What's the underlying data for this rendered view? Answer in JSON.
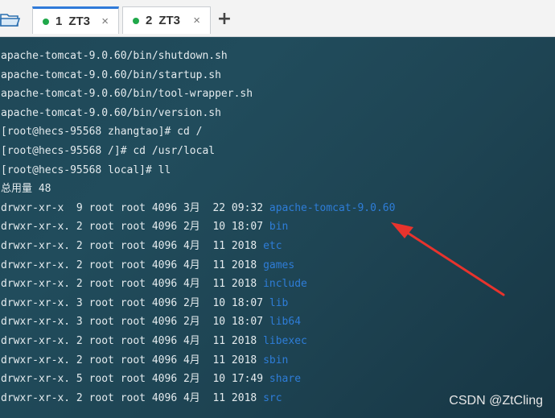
{
  "tabs": [
    {
      "number": "1",
      "label": "ZT3",
      "close": "×",
      "active": true
    },
    {
      "number": "2",
      "label": "ZT3",
      "close": "×",
      "active": false
    }
  ],
  "new_tab_label": "+",
  "toolbar": {
    "folder_icon": "folder-icon"
  },
  "terminal": {
    "lines": [
      {
        "text": "apache-tomcat-9.0.60/bin/shutdown.sh"
      },
      {
        "text": "apache-tomcat-9.0.60/bin/startup.sh"
      },
      {
        "text": "apache-tomcat-9.0.60/bin/tool-wrapper.sh"
      },
      {
        "text": "apache-tomcat-9.0.60/bin/version.sh"
      },
      {
        "text": "[root@hecs-95568 zhangtao]# cd /"
      },
      {
        "text": "[root@hecs-95568 /]# cd /usr/local"
      },
      {
        "text": "[root@hecs-95568 local]# ll"
      },
      {
        "text": "总用量 48"
      },
      {
        "text": "drwxr-xr-x  9 root root 4096 3月  22 09:32 ",
        "dir": "apache-tomcat-9.0.60"
      },
      {
        "text": "drwxr-xr-x. 2 root root 4096 2月  10 18:07 ",
        "dir": "bin"
      },
      {
        "text": "drwxr-xr-x. 2 root root 4096 4月  11 2018 ",
        "dir": "etc"
      },
      {
        "text": "drwxr-xr-x. 2 root root 4096 4月  11 2018 ",
        "dir": "games"
      },
      {
        "text": "drwxr-xr-x. 2 root root 4096 4月  11 2018 ",
        "dir": "include"
      },
      {
        "text": "drwxr-xr-x. 3 root root 4096 2月  10 18:07 ",
        "dir": "lib"
      },
      {
        "text": "drwxr-xr-x. 3 root root 4096 2月  10 18:07 ",
        "dir": "lib64"
      },
      {
        "text": "drwxr-xr-x. 2 root root 4096 4月  11 2018 ",
        "dir": "libexec"
      },
      {
        "text": "drwxr-xr-x. 2 root root 4096 4月  11 2018 ",
        "dir": "sbin"
      },
      {
        "text": "drwxr-xr-x. 5 root root 4096 2月  10 17:49 ",
        "dir": "share"
      },
      {
        "text": "drwxr-xr-x. 2 root root 4096 4月  11 2018 ",
        "dir": "src"
      }
    ]
  },
  "annotation": {
    "icon": "red-arrow-icon",
    "color": "#e8332d"
  },
  "watermark": "CSDN @ZtCling",
  "colors": {
    "terminal_bg": "#1f4858",
    "text": "#e4ebee",
    "directory": "#2e7dd8",
    "tab_active_accent": "#2f7ad9",
    "tab_dot": "#20a84a"
  }
}
